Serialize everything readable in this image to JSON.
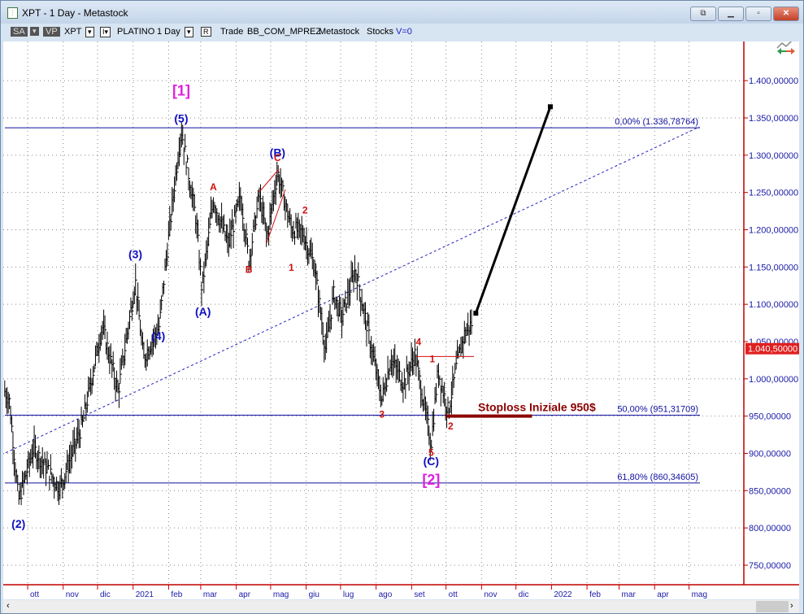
{
  "window": {
    "title": "XPT - 1 Day - Metastock",
    "buttons": [
      "popout",
      "minimize",
      "restore",
      "close"
    ]
  },
  "toolbar": {
    "sa": "SA",
    "vp": "VP",
    "symbol": "XPT",
    "name": "PLATINO",
    "period": "1 Day",
    "r": "R",
    "trade": "Trade",
    "account": "BB_COM_MPREZ",
    "source": "Metastock",
    "type": "Stocks",
    "v": "V=0"
  },
  "chart_data": {
    "type": "line",
    "title": "XPT - 1 Day",
    "ylim": [
      700,
      1450
    ],
    "xlim": [
      "2020-09-08",
      "2022-06-16"
    ],
    "y_ticks": [
      "1.400,00000",
      "1.350,00000",
      "1.300,00000",
      "1.250,00000",
      "1.200,00000",
      "1.150,00000",
      "1.100,00000",
      "1.050,00000",
      "1.000,00000",
      "950,00000",
      "900,00000",
      "850,00000",
      "800,00000",
      "750,00000"
    ],
    "y_tick_values": [
      1400,
      1350,
      1300,
      1250,
      1200,
      1150,
      1100,
      1050,
      1000,
      950,
      900,
      850,
      800,
      750
    ],
    "x_ticks": [
      {
        "d": "2020-10-01",
        "l": "ott"
      },
      {
        "d": "2020-11-01",
        "l": "nov"
      },
      {
        "d": "2020-12-01",
        "l": "dic"
      },
      {
        "d": "2021-01-01",
        "l": "2021"
      },
      {
        "d": "2021-02-01",
        "l": "feb"
      },
      {
        "d": "2021-03-01",
        "l": "mar"
      },
      {
        "d": "2021-04-01",
        "l": "apr"
      },
      {
        "d": "2021-05-01",
        "l": "mag"
      },
      {
        "d": "2021-06-01",
        "l": "giu"
      },
      {
        "d": "2021-07-01",
        "l": "lug"
      },
      {
        "d": "2021-08-01",
        "l": "ago"
      },
      {
        "d": "2021-09-01",
        "l": "set"
      },
      {
        "d": "2021-10-01",
        "l": "ott"
      },
      {
        "d": "2021-11-01",
        "l": "nov"
      },
      {
        "d": "2021-12-01",
        "l": "dic"
      },
      {
        "d": "2022-01-01",
        "l": "2022"
      },
      {
        "d": "2022-02-01",
        "l": "feb"
      },
      {
        "d": "2022-03-01",
        "l": "mar"
      },
      {
        "d": "2022-04-01",
        "l": "apr"
      },
      {
        "d": "2022-05-01",
        "l": "mag"
      }
    ],
    "last_price": "1.040,50000",
    "last_value": 1040.5,
    "price_pivots": [
      [
        "2020-09-11",
        983
      ],
      [
        "2020-09-15",
        972
      ],
      [
        "2020-09-23",
        836
      ],
      [
        "2020-10-06",
        907
      ],
      [
        "2020-10-29",
        853
      ],
      [
        "2020-11-18",
        940
      ],
      [
        "2020-12-05",
        1071
      ],
      [
        "2020-12-19",
        983
      ],
      [
        "2021-01-03",
        1131
      ],
      [
        "2021-01-10",
        1027
      ],
      [
        "2021-01-24",
        1071
      ],
      [
        "2021-01-27",
        1120
      ],
      [
        "2021-02-07",
        1272
      ],
      [
        "2021-02-12",
        1335
      ],
      [
        "2021-02-25",
        1213
      ],
      [
        "2021-03-02",
        1120
      ],
      [
        "2021-03-12",
        1240
      ],
      [
        "2021-03-25",
        1180
      ],
      [
        "2021-04-05",
        1245
      ],
      [
        "2021-04-12",
        1158
      ],
      [
        "2021-04-21",
        1245
      ],
      [
        "2021-04-28",
        1190
      ],
      [
        "2021-05-07",
        1278
      ],
      [
        "2021-05-19",
        1202
      ],
      [
        "2021-05-29",
        1196
      ],
      [
        "2021-06-08",
        1153
      ],
      [
        "2021-06-18",
        1038
      ],
      [
        "2021-06-25",
        1114
      ],
      [
        "2021-07-02",
        1082
      ],
      [
        "2021-07-14",
        1147
      ],
      [
        "2021-07-24",
        1071
      ],
      [
        "2021-08-06",
        972
      ],
      [
        "2021-08-14",
        1027
      ],
      [
        "2021-08-25",
        994
      ],
      [
        "2021-09-04",
        1033
      ],
      [
        "2021-09-18",
        912
      ],
      [
        "2021-09-24",
        1011
      ],
      [
        "2021-10-03",
        956
      ],
      [
        "2021-10-10",
        1016
      ],
      [
        "2021-10-17",
        1060
      ],
      [
        "2021-10-24",
        1076
      ]
    ],
    "fib_levels": [
      {
        "label": "0,00% (1.336,78764)",
        "value": 1336.79
      },
      {
        "label": "50,00% (951,31709)",
        "value": 951.32
      },
      {
        "label": "61,80% (860,34605)",
        "value": 860.35
      }
    ],
    "trendline": [
      [
        "2020-09-08",
        898
      ],
      [
        "2022-05-10",
        1338
      ]
    ],
    "projection_arrow": [
      [
        "2021-10-27",
        1088
      ],
      [
        "2021-12-31",
        1365
      ]
    ],
    "stoploss": {
      "label": "Stoploss Iniziale 950$",
      "value": 950,
      "from": "2021-10-01",
      "to": "2021-12-15"
    },
    "wave_labels": [
      {
        "t": "[1]",
        "d": "2021-02-12",
        "p": 1380,
        "c": "#e020e0",
        "s": 18
      },
      {
        "t": "(5)",
        "d": "2021-02-12",
        "p": 1344,
        "c": "#1010c0",
        "s": 14
      },
      {
        "t": "(B)",
        "d": "2021-05-07",
        "p": 1298,
        "c": "#1010c0",
        "s": 14
      },
      {
        "t": "(3)",
        "d": "2021-01-03",
        "p": 1162,
        "c": "#1010c0",
        "s": 14
      },
      {
        "t": "(4)",
        "d": "2021-01-23",
        "p": 1052,
        "c": "#1010c0",
        "s": 14
      },
      {
        "t": "(A)",
        "d": "2021-03-03",
        "p": 1085,
        "c": "#1010c0",
        "s": 14
      },
      {
        "t": "(2)",
        "d": "2020-09-23",
        "p": 800,
        "c": "#1010c0",
        "s": 14
      },
      {
        "t": "(C)",
        "d": "2021-09-18",
        "p": 884,
        "c": "#1010c0",
        "s": 14
      },
      {
        "t": "[2]",
        "d": "2021-09-18",
        "p": 858,
        "c": "#e020e0",
        "s": 18
      },
      {
        "t": "A",
        "d": "2021-03-12",
        "p": 1253,
        "c": "#d01010",
        "s": 12
      },
      {
        "t": "B",
        "d": "2021-04-12",
        "p": 1142,
        "c": "#d01010",
        "s": 12
      },
      {
        "t": "C",
        "d": "2021-05-07",
        "p": 1292,
        "c": "#d01010",
        "s": 12
      },
      {
        "t": "2",
        "d": "2021-05-31",
        "p": 1222,
        "c": "#d01010",
        "s": 12
      },
      {
        "t": "1",
        "d": "2021-05-19",
        "p": 1145,
        "c": "#d01010",
        "s": 12
      },
      {
        "t": "4",
        "d": "2021-09-07",
        "p": 1045,
        "c": "#d01010",
        "s": 12
      },
      {
        "t": "1",
        "d": "2021-09-19",
        "p": 1022,
        "c": "#d01010",
        "s": 12
      },
      {
        "t": "3",
        "d": "2021-08-06",
        "p": 948,
        "c": "#d01010",
        "s": 12
      },
      {
        "t": "5",
        "d": "2021-09-18",
        "p": 897,
        "c": "#d01010",
        "s": 12
      },
      {
        "t": "2",
        "d": "2021-10-05",
        "p": 932,
        "c": "#d01010",
        "s": 12
      }
    ]
  },
  "colors": {
    "axis": "#c00000",
    "grid": "#888888",
    "fib": "#1010a0",
    "labels": "#1a1aa8",
    "stoploss": "#8b0000"
  }
}
